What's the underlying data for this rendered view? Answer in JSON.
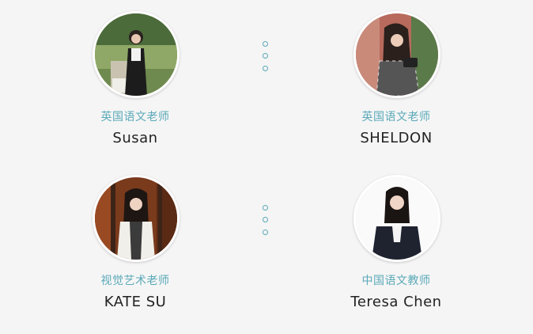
{
  "teachers": [
    {
      "role": "英国语文老师",
      "name": "Susan",
      "photo_icon": "teacher-photo-susan"
    },
    {
      "role": "英国语文老师",
      "name": "SHELDON",
      "photo_icon": "teacher-photo-sheldon"
    },
    {
      "role": "视觉艺术老师",
      "name": "KATE SU",
      "photo_icon": "teacher-photo-kate-su"
    },
    {
      "role": "中国语文教师",
      "name": "Teresa Chen",
      "photo_icon": "teacher-photo-teresa-chen"
    }
  ],
  "colors": {
    "background": "#f5f5f5",
    "role_text": "#5aa9b8",
    "name_text": "#222222",
    "dot_accent": "#5aa9b8"
  }
}
